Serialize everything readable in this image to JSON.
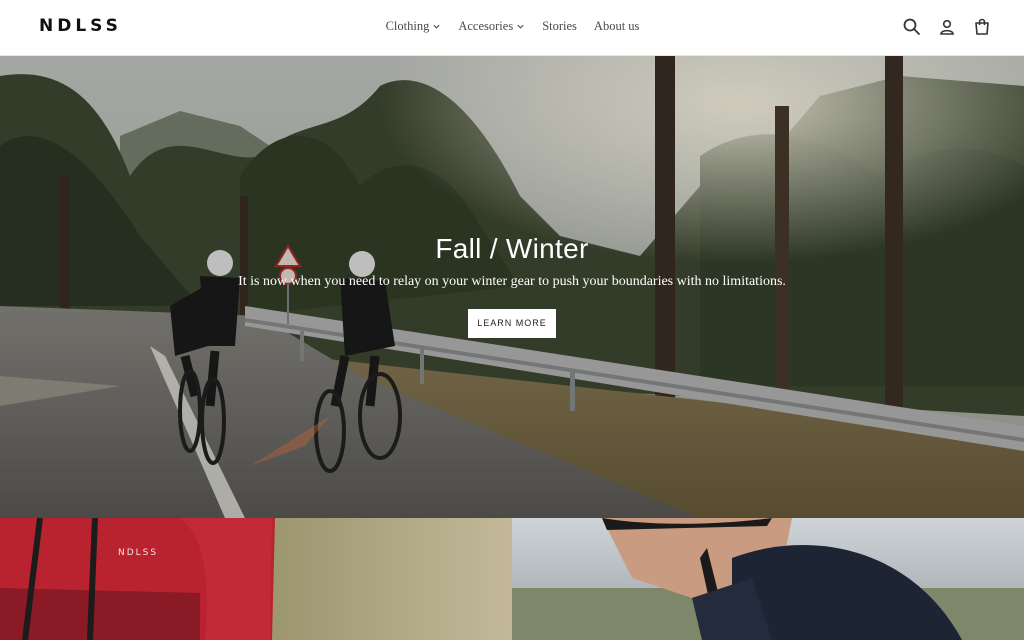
{
  "brand": {
    "logo": "NDLSS"
  },
  "nav": {
    "items": [
      {
        "label": "Clothing",
        "dropdown": true
      },
      {
        "label": "Accesories",
        "dropdown": true
      },
      {
        "label": "Stories",
        "dropdown": false
      },
      {
        "label": "About us",
        "dropdown": false
      }
    ]
  },
  "header_icons": [
    "search-icon",
    "account-icon",
    "cart-icon"
  ],
  "hero": {
    "title": "Fall / Winter",
    "subtitle": "It is now when you need to relay on your winter gear to push your boundaries with no limitations.",
    "button_label": "LEARN MORE"
  },
  "tiles": {
    "left": {
      "jersey_logo": "NDLSS"
    }
  },
  "colors": {
    "text": "#4a4a4a",
    "button_bg": "#ffffff",
    "jersey_red": "#b8232f"
  }
}
